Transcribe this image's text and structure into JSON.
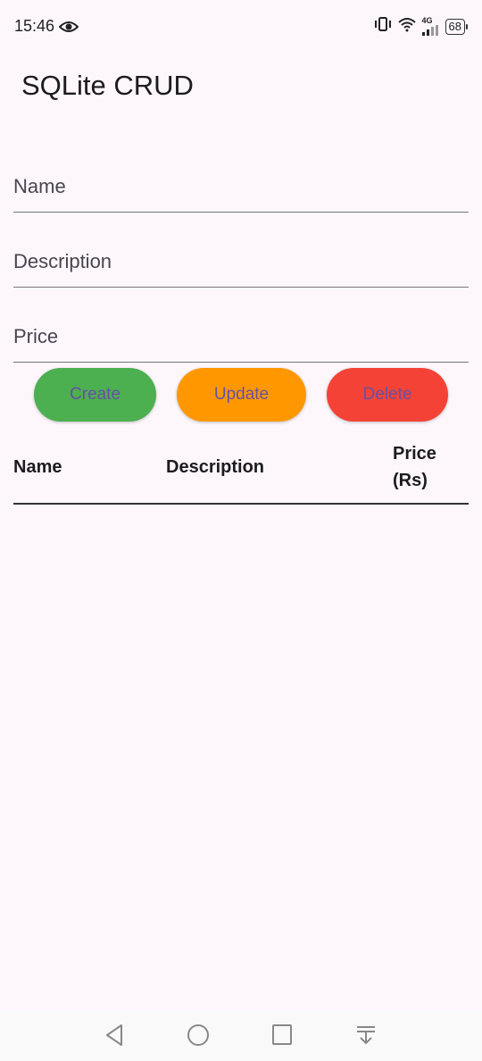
{
  "status_bar": {
    "time": "15:46",
    "network": "4G",
    "battery": "68",
    "icons": [
      "eye-icon",
      "vibrate-icon",
      "wifi-icon",
      "signal-icon",
      "battery-icon"
    ]
  },
  "app_bar": {
    "title": "SQLite CRUD"
  },
  "form": {
    "name_placeholder": "Name",
    "description_placeholder": "Description",
    "price_placeholder": "Price",
    "name_value": "",
    "description_value": "",
    "price_value": ""
  },
  "buttons": {
    "create_label": "Create",
    "update_label": "Update",
    "delete_label": "Delete",
    "create_color": "#4CAF50",
    "update_color": "#FF9800",
    "delete_color": "#F44336",
    "label_color": "#6750A4"
  },
  "table": {
    "columns": [
      "Name",
      "Description",
      "Price",
      "(Rs)"
    ],
    "rows": []
  },
  "nav_bar": {
    "icons": [
      "back-icon",
      "home-icon",
      "recents-icon",
      "notification-pull-icon"
    ]
  },
  "colors": {
    "background": "#FDF7FC",
    "text": "#1D1B20",
    "underline": "#79747E"
  }
}
